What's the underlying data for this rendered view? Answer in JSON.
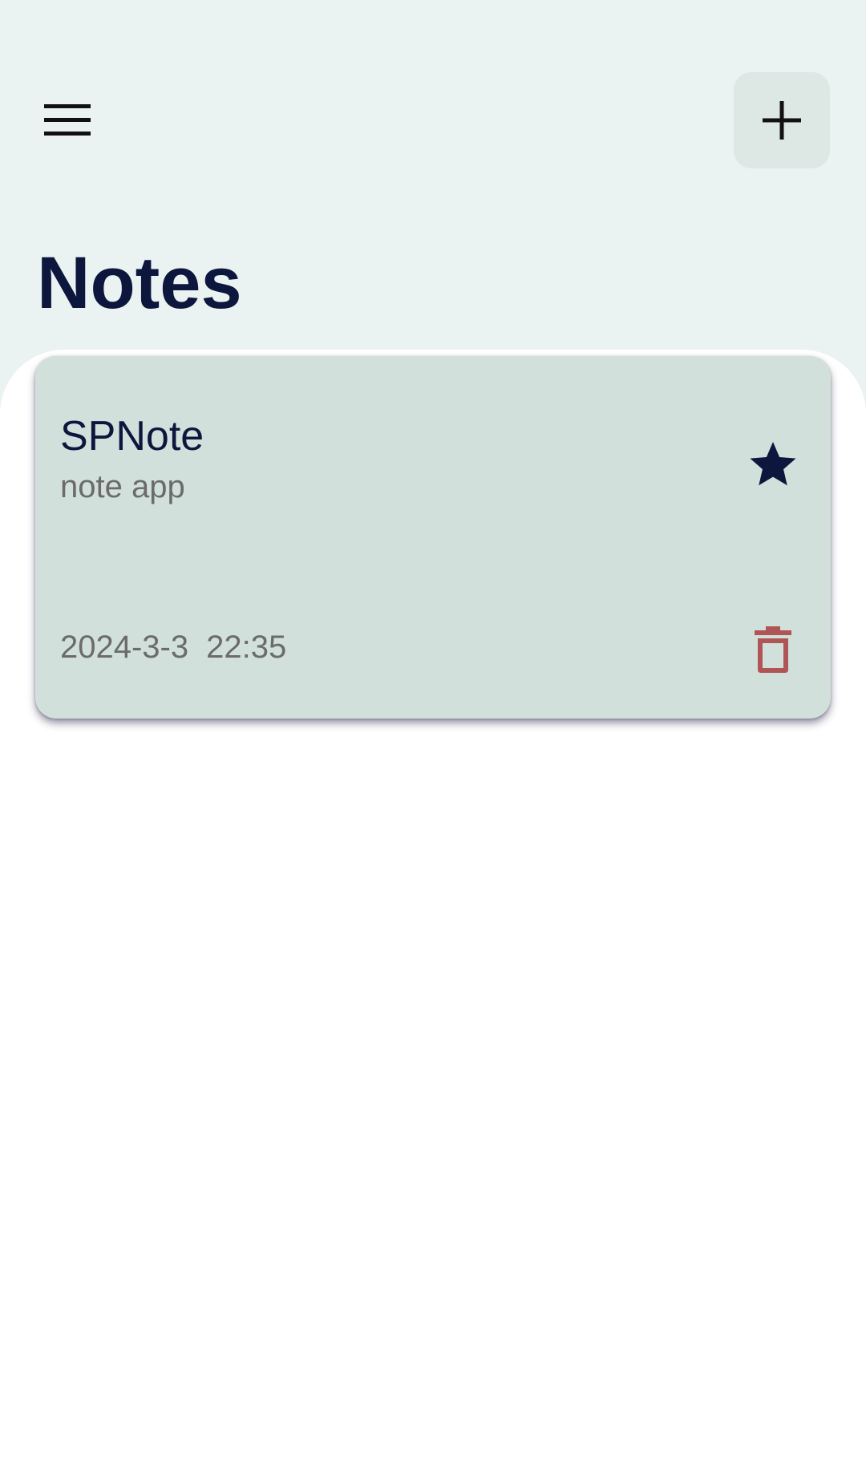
{
  "app": {
    "title": "Notes"
  },
  "header": {
    "menu_icon": "hamburger-menu-icon",
    "add_icon": "plus-icon"
  },
  "notes": [
    {
      "title": "SPNote",
      "content": "note app",
      "date": "2024-3-3",
      "time": "22:35",
      "starred": true,
      "star_icon": "star-icon",
      "delete_icon": "trash-icon"
    }
  ],
  "colors": {
    "background_top": "#eaf3f1",
    "card": "#d2e0dc",
    "title_text": "#0d163d",
    "secondary_text": "#6b6b6b",
    "star": "#0d163d",
    "delete": "#b05555",
    "add_button_bg": "#dde8e4"
  }
}
